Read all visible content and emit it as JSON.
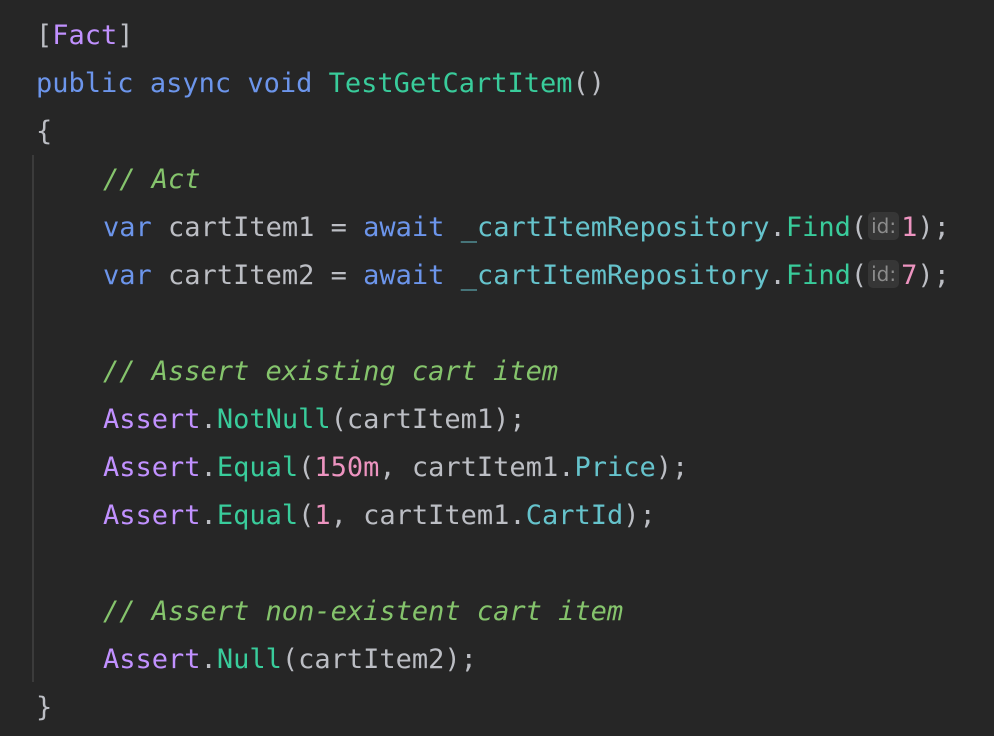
{
  "code": {
    "line1": {
      "attribute": "Fact",
      "open": "[",
      "close": "]"
    },
    "line2": {
      "kw_public": "public",
      "kw_async": "async",
      "kw_void": "void",
      "method": "TestGetCartItem",
      "parens": "()"
    },
    "line3": {
      "brace": "{"
    },
    "line4": {
      "comment": "// Act"
    },
    "line5": {
      "kw_var": "var",
      "name": "cartItem1",
      "eq": " = ",
      "kw_await": "await",
      "field": "_cartItemRepository",
      "dot": ".",
      "method": "Find",
      "open": "(",
      "hint": "id:",
      "arg": "1",
      "close": ");"
    },
    "line6": {
      "kw_var": "var",
      "name": "cartItem2",
      "eq": " = ",
      "kw_await": "await",
      "field": "_cartItemRepository",
      "dot": ".",
      "method": "Find",
      "open": "(",
      "hint": "id:",
      "arg": "7",
      "close": ");"
    },
    "line8": {
      "comment": "// Assert existing cart item"
    },
    "line9": {
      "class": "Assert",
      "dot": ".",
      "method": "NotNull",
      "args": "(cartItem1);"
    },
    "line10": {
      "class": "Assert",
      "dot": ".",
      "method": "Equal",
      "open": "(",
      "num": "150m",
      "mid": ", cartItem1.",
      "prop": "Price",
      "close": ");"
    },
    "line11": {
      "class": "Assert",
      "dot": ".",
      "method": "Equal",
      "open": "(",
      "num": "1",
      "mid": ", cartItem1.",
      "prop": "CartId",
      "close": ");"
    },
    "line13": {
      "comment": "// Assert non-existent cart item"
    },
    "line14": {
      "class": "Assert",
      "dot": ".",
      "method": "Null",
      "args": "(cartItem2);"
    },
    "line15": {
      "brace": "}"
    }
  },
  "colors": {
    "background": "#262626",
    "keyword": "#6c95eb",
    "method": "#39cc9b",
    "attribute_class": "#c191ff",
    "comment": "#85c46c",
    "number": "#ed94c0",
    "property": "#66c3cc",
    "text": "#bcbec4"
  }
}
